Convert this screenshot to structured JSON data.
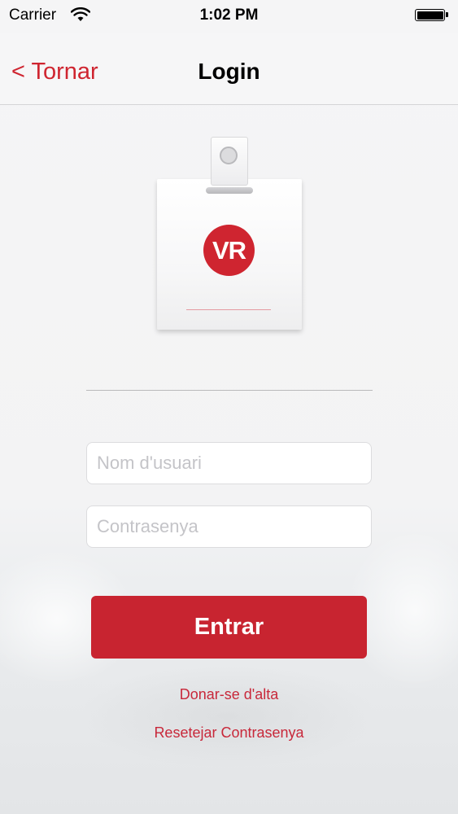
{
  "status_bar": {
    "carrier": "Carrier",
    "time": "1:02 PM"
  },
  "nav": {
    "back_label": "< Tornar",
    "title": "Login"
  },
  "badge": {
    "logo_text": "VR"
  },
  "form": {
    "username_placeholder": "Nom d'usuari",
    "password_placeholder": "Contrasenya",
    "submit_label": "Entrar"
  },
  "links": {
    "signup": "Donar-se d'alta",
    "reset_password": "Resetejar Contrasenya"
  },
  "colors": {
    "accent": "#cf2530",
    "button": "#c82430"
  }
}
